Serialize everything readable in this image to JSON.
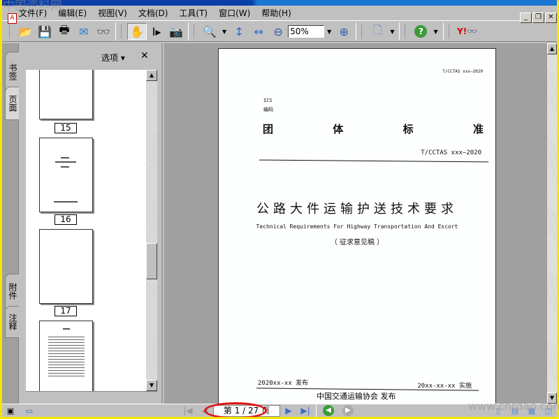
{
  "menu": [
    "文件(F)",
    "编辑(E)",
    "视图(V)",
    "文档(D)",
    "工具(T)",
    "窗口(W)",
    "帮助(H)"
  ],
  "window_controls": {
    "minimize": "_",
    "restore": "❐",
    "close": "✕"
  },
  "toolbar": {
    "zoom_value": "50%"
  },
  "left_tabs": {
    "bookmarks": "书签",
    "pages": "页面",
    "attachments": "附件",
    "comments": "注释"
  },
  "panel": {
    "options_label": "选项",
    "close": "✕",
    "thumbnails": [
      "15",
      "16",
      "17"
    ]
  },
  "document": {
    "header_code": "T/CCTAS xxx—2020",
    "ics": "ICS",
    "code_label": "编码",
    "std_chars": [
      "团",
      "体",
      "标",
      "准"
    ],
    "std_number": "T/CCTAS xxx—2020",
    "title_cn": "公路大件运输护送技术要求",
    "title_en": "Technical Requirements For Highway Transportation And Escort",
    "draft_note": "（ 征求意见稿 ）",
    "publish_date": "2020xx-xx 发布",
    "effective_date": "20xx-xx-xx 实施",
    "publisher": "中国交通运输协会  发布"
  },
  "status": {
    "page_indicator": "第 1 / 27 页",
    "current_page": 1,
    "total_pages": 27
  },
  "watermarks": {
    "top": "中国资料网",
    "bottom": "www.cnrdao.com"
  },
  "colors": {
    "title_bar": "#0a3ea8",
    "highlight_oval": "#e01010",
    "frame": "#f5e600"
  }
}
